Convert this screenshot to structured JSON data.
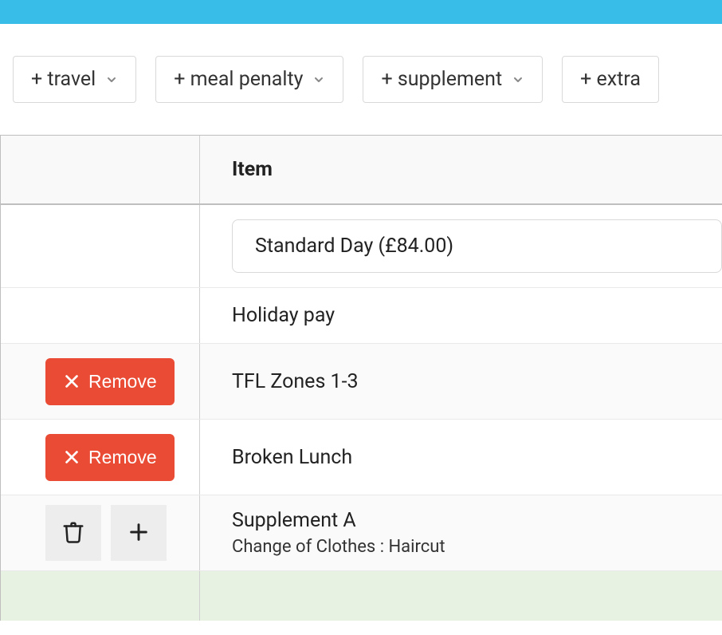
{
  "toolbar": {
    "travel": "+ travel",
    "meal_penalty": "+ meal penalty",
    "supplement": "+ supplement",
    "extra": "+ extra"
  },
  "table": {
    "header_item": "Item",
    "rows": {
      "day_select_value": "Standard Day (£84.00)",
      "holiday_pay": "Holiday pay",
      "tfl": "TFL Zones 1-3",
      "broken_lunch": "Broken Lunch",
      "supplement_title": "Supplement A",
      "supplement_detail": "Change of Clothes : Haircut"
    },
    "remove_label": "Remove"
  },
  "colors": {
    "accent": "#37bde8",
    "danger": "#e94b35",
    "footer_bg": "#e8f2e3"
  }
}
